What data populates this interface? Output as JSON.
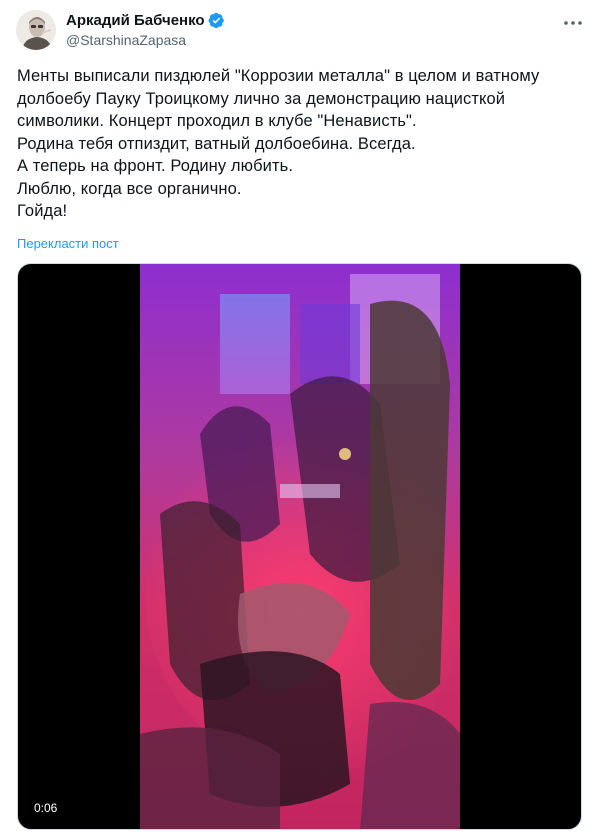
{
  "author": {
    "display_name": "Аркадий Бабченко",
    "handle": "@StarshinaZapasa",
    "verified_icon": "verified-badge-icon",
    "verified_color": "#1d9bf0"
  },
  "tweet": {
    "lines": [
      "Менты выписали пиздюлей \"Коррозии металла\" в целом и ватному",
      "долбоебу Пауку Троицкому лично за демонстрацию нацисткой",
      "символики. Концерт проходил в клубе \"Ненависть\".",
      "Родина тебя отпиздит, ватный долбоебина. Всегда.",
      "А теперь на фронт. Родину любить.",
      "Люблю, когда все органично.",
      "Гойда!"
    ],
    "translate_label": "Перекласти пост"
  },
  "media": {
    "type": "video",
    "duration": "0:06"
  },
  "colors": {
    "text": "#0f1419",
    "secondary": "#536471",
    "link": "#1d9bf0"
  }
}
